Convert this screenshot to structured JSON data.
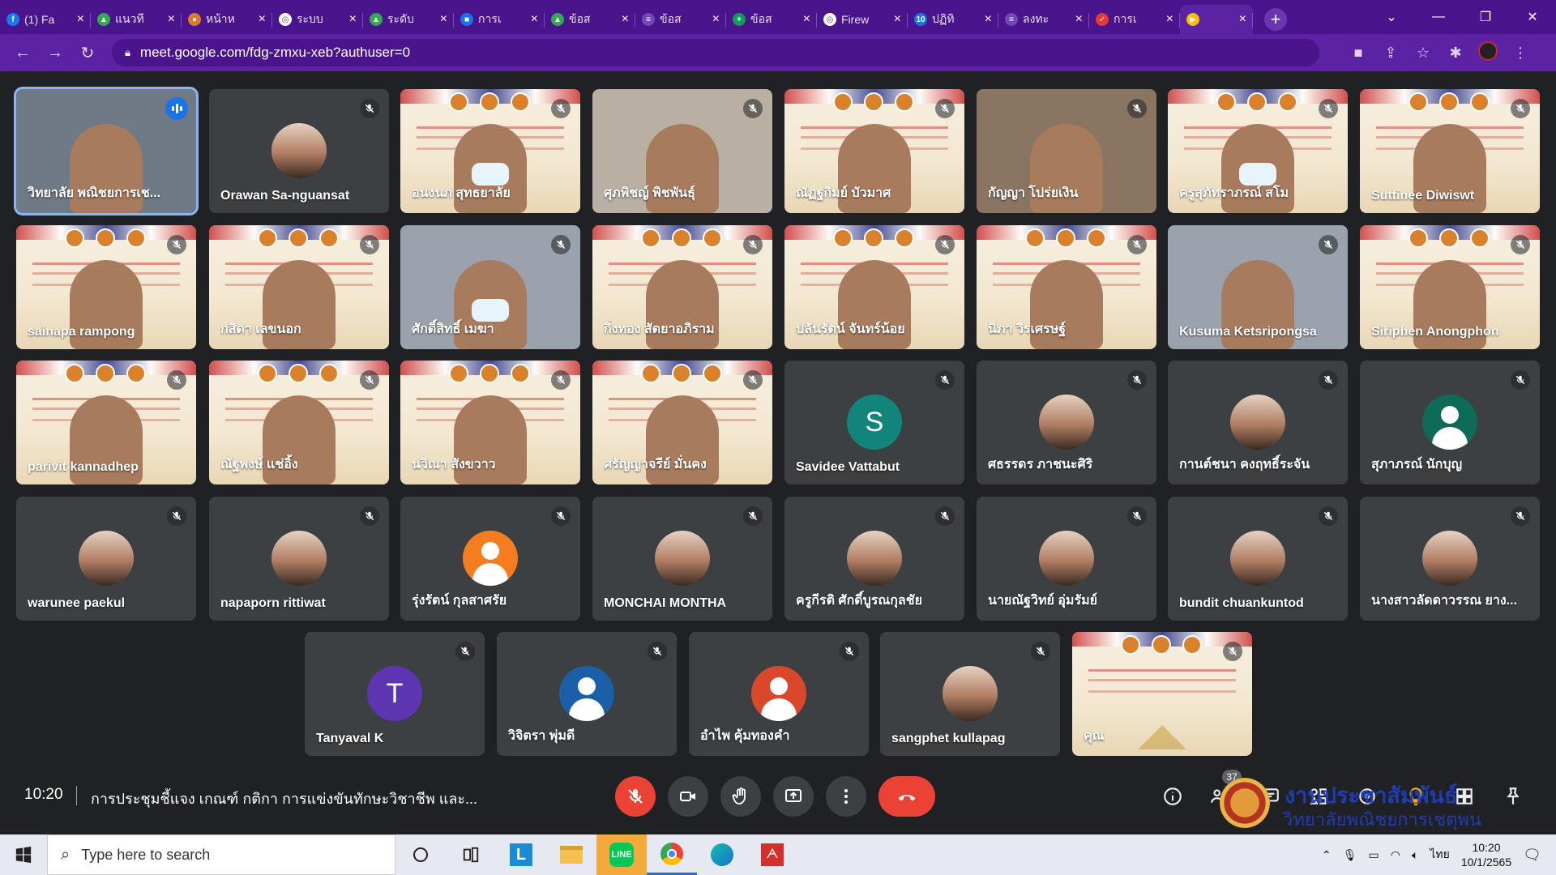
{
  "browser": {
    "tabs": [
      {
        "label": "(1) Fa",
        "fav_color": "#1877f2",
        "fav_glyph": "f"
      },
      {
        "label": "แนวที",
        "fav_color": "#34a853",
        "fav_glyph": "▲"
      },
      {
        "label": "หน้าห",
        "fav_color": "#d97b29",
        "fav_glyph": "●"
      },
      {
        "label": "ระบบ",
        "fav_color": "#ffffff",
        "fav_glyph": "◎"
      },
      {
        "label": "ระดับ",
        "fav_color": "#34a853",
        "fav_glyph": "▲"
      },
      {
        "label": "การเ",
        "fav_color": "#1a73e8",
        "fav_glyph": "■"
      },
      {
        "label": "ข้อส",
        "fav_color": "#34a853",
        "fav_glyph": "▲"
      },
      {
        "label": "ข้อส",
        "fav_color": "#7248b9",
        "fav_glyph": "≡"
      },
      {
        "label": "ข้อส",
        "fav_color": "#0f9d58",
        "fav_glyph": "+"
      },
      {
        "label": "Firew",
        "fav_color": "#ffffff",
        "fav_glyph": "◎"
      },
      {
        "label": "ปฏิทิ",
        "fav_color": "#1a73e8",
        "fav_glyph": "10"
      },
      {
        "label": "ลงทะ",
        "fav_color": "#7248b9",
        "fav_glyph": "≡"
      },
      {
        "label": "การเ",
        "fav_color": "#e53935",
        "fav_glyph": "✓"
      },
      {
        "label": "",
        "fav_color": "#fbbc05",
        "fav_glyph": "▶"
      }
    ],
    "url": "meet.google.com/fdg-zmxu-xeb?authuser=0",
    "new_tab_label": "+",
    "window_controls": [
      "⌄",
      "—",
      "❐",
      "✕"
    ]
  },
  "participants": [
    {
      "name": "วิทยาลัย พณิชยการเช...",
      "kind": "video",
      "speaking": true
    },
    {
      "name": "Orawan Sa-nguansat",
      "kind": "photo"
    },
    {
      "name": "อนงนภ สุทธยาลัย",
      "kind": "banner",
      "mask": true
    },
    {
      "name": "ศุภพิชญ์ พิชพันธุ์",
      "kind": "video"
    },
    {
      "name": "ณัฏฐกิมย์ บัวมาศ",
      "kind": "banner"
    },
    {
      "name": "กัญญา โปร่ยเงิน",
      "kind": "video"
    },
    {
      "name": "ครูสุภัทราภรณ์ สโม",
      "kind": "banner",
      "mask": true
    },
    {
      "name": "Suttinee Diwiswt",
      "kind": "banner"
    },
    {
      "name": "sainapa rampong",
      "kind": "banner"
    },
    {
      "name": "กสิดา เลขนอก",
      "kind": "banner"
    },
    {
      "name": "ศักดิ์สิทธิ์ เมฆา",
      "kind": "video",
      "mask": true
    },
    {
      "name": "กิ่งทอง สัตยาอภิราม",
      "kind": "banner"
    },
    {
      "name": "ปลันรัตน์ จันทร์น้อย",
      "kind": "banner"
    },
    {
      "name": "นิภา วิรเศรษฐ์",
      "kind": "banner"
    },
    {
      "name": "Kusuma Ketsripongsa",
      "kind": "video"
    },
    {
      "name": "Siriphen Anongphon",
      "kind": "banner"
    },
    {
      "name": "parivit kannadhep",
      "kind": "banner"
    },
    {
      "name": "ณัฐพงษ์ แช่อิ้ง",
      "kind": "banner"
    },
    {
      "name": "นวิณา สังขวาว",
      "kind": "banner"
    },
    {
      "name": "ศรัญญาจรีย์ มั่นคง",
      "kind": "banner"
    },
    {
      "name": "Savidee Vattabut",
      "kind": "letter",
      "letter": "S",
      "color": "#12857a"
    },
    {
      "name": "ศธรรดร ภาชนะศิริ",
      "kind": "photo"
    },
    {
      "name": "กานต์ชนา คงฤทธิ์ระจัน",
      "kind": "photo"
    },
    {
      "name": "สุภาภรณ์ นักบุญ",
      "kind": "generic",
      "color": "#0d6b57"
    },
    {
      "name": "warunee paekul",
      "kind": "photo"
    },
    {
      "name": "napaporn rittiwat",
      "kind": "photo"
    },
    {
      "name": "รุ่งรัตน์ กุลสาศรัย",
      "kind": "generic",
      "color": "#f57c1f"
    },
    {
      "name": "MONCHAI MONTHA",
      "kind": "photo"
    },
    {
      "name": "ครูกีรติ ศักดิ์บูรณกุลชัย",
      "kind": "photo"
    },
    {
      "name": "นายณัฐวิทย์ อุ่มรัมย์",
      "kind": "photo"
    },
    {
      "name": "bundit chuankuntod",
      "kind": "photo"
    },
    {
      "name": "นางสาวลัดดาวรรณ ยาง...",
      "kind": "photo"
    },
    {
      "name": "Tanyaval K",
      "kind": "letter",
      "letter": "T",
      "color": "#5e35b1"
    },
    {
      "name": "วิจิตรา พุ่มดี",
      "kind": "generic",
      "color": "#1a5fa8"
    },
    {
      "name": "อำไพ คุ้มทองคำ",
      "kind": "generic",
      "color": "#d9482b"
    },
    {
      "name": "sangphet kullapag",
      "kind": "photo"
    },
    {
      "name": "คุณ",
      "kind": "banner"
    }
  ],
  "meeting": {
    "time": "10:20",
    "title": "การประชุมชี้แจง เกณฑ์ กติกา การแข่งขันทักษะวิชาชีพ และ...",
    "participant_count": "37"
  },
  "watermark": {
    "line1": "งานประชาสัมพันธ์",
    "line2": "วิทยาลัยพณิชยการเชตุพน"
  },
  "taskbar": {
    "search_placeholder": "Type here to search",
    "lang": "ไทย",
    "time": "10:20",
    "date": "10/1/2565"
  }
}
